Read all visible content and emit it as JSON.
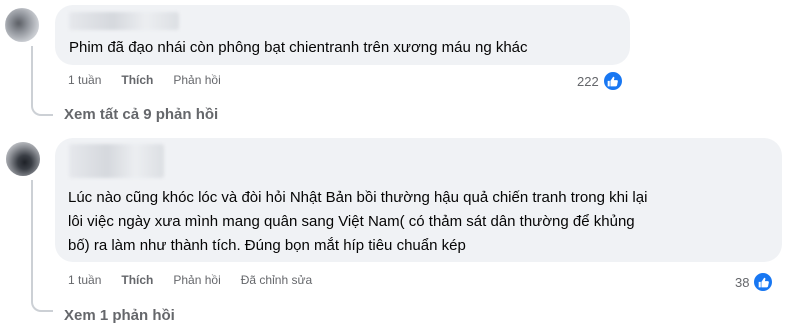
{
  "comments": [
    {
      "text_lines": [
        "Phim đã đạo nhái còn phông bạt chientranh trên xương máu ng khác"
      ],
      "time": "1 tuần",
      "like_label": "Thích",
      "reply_label": "Phản hồi",
      "reaction_count": "222",
      "view_replies": "Xem tất cả 9 phản hồi"
    },
    {
      "text_lines": [
        "Lúc nào cũng khóc lóc và đòi hỏi Nhật Bản bồi thường hậu quả chiến tranh trong khi lại",
        "lôi việc ngày xưa mình mang quân sang Việt Nam( có thảm sát dân thường để khủng",
        "bố) ra làm như thành tích. Đúng bọn mắt híp tiêu chuẩn kép"
      ],
      "time": "1 tuần",
      "like_label": "Thích",
      "reply_label": "Phản hồi",
      "edited_label": "Đã chỉnh sửa",
      "reaction_count": "38",
      "view_replies": "Xem 1 phản hồi"
    }
  ],
  "icons": {
    "reaction": "thumbs-up-icon"
  },
  "colors": {
    "accent": "#1877f2",
    "bubble": "#f0f2f5",
    "meta": "#65676b"
  }
}
